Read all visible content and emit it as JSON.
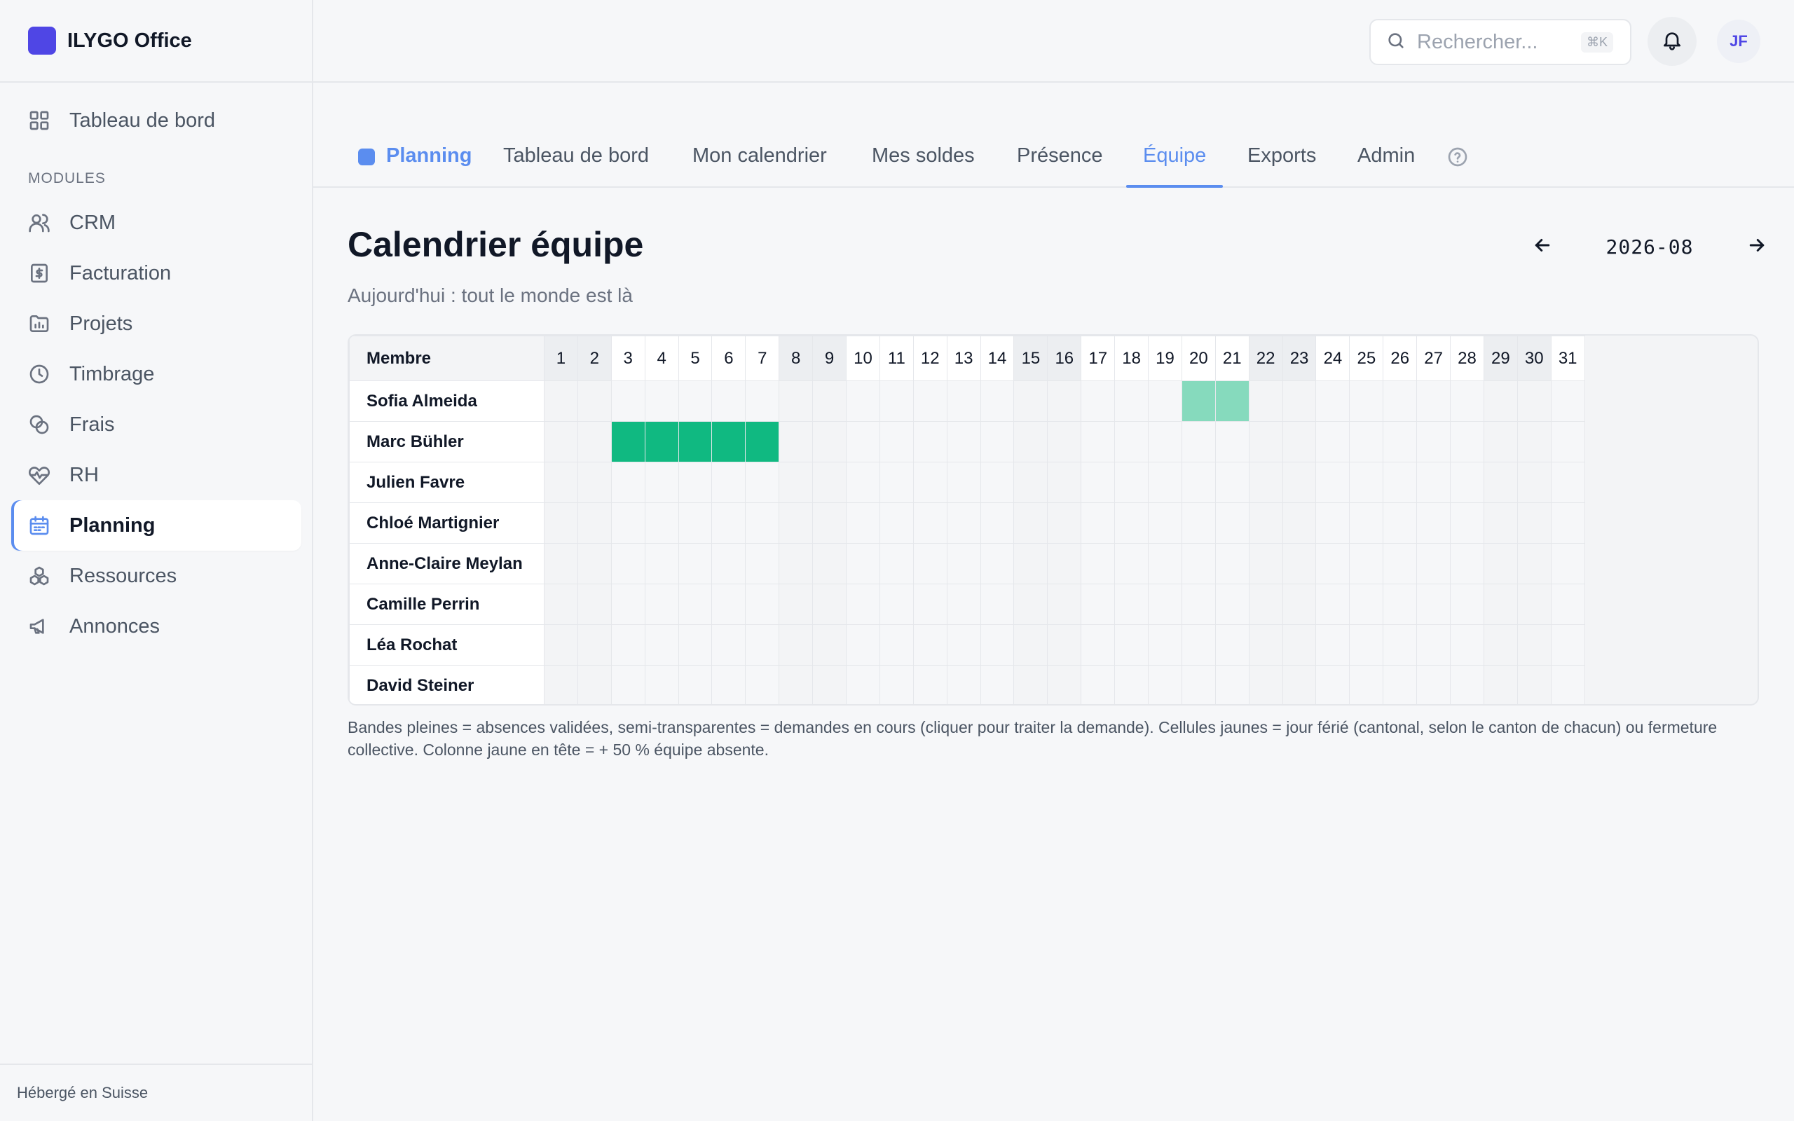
{
  "app": {
    "name": "ILYGO Office"
  },
  "sidebar": {
    "top_item": {
      "label": "Tableau de bord",
      "icon": "grid-icon"
    },
    "section_label": "MODULES",
    "items": [
      {
        "label": "CRM",
        "icon": "users-icon"
      },
      {
        "label": "Facturation",
        "icon": "invoice-icon"
      },
      {
        "label": "Projets",
        "icon": "folder-chart-icon"
      },
      {
        "label": "Timbrage",
        "icon": "clock-icon"
      },
      {
        "label": "Frais",
        "icon": "coins-icon"
      },
      {
        "label": "RH",
        "icon": "heart-pulse-icon"
      },
      {
        "label": "Planning",
        "icon": "calendar-icon",
        "active": true
      },
      {
        "label": "Ressources",
        "icon": "boxes-icon"
      },
      {
        "label": "Annonces",
        "icon": "megaphone-icon"
      }
    ],
    "footer": "Hébergé en Suisse"
  },
  "topbar": {
    "search_placeholder": "Rechercher...",
    "search_shortcut": "⌘K",
    "avatar_initials": "JF"
  },
  "tabs": {
    "home": "Planning",
    "items": [
      "Tableau de bord",
      "Mon calendrier",
      "Mes soldes",
      "Présence",
      "Équipe",
      "Exports",
      "Admin"
    ],
    "active": "Équipe"
  },
  "main": {
    "title": "Calendrier équipe",
    "subtitle": "Aujourd'hui : tout le monde est là",
    "month": "2026-08",
    "legend": "Bandes pleines = absences validées, semi-transparentes = demandes en cours (cliquer pour traiter la demande). Cellules jaunes = jour férié (cantonal, selon le canton de chacun) ou fermeture collective. Colonne jaune en tête = + 50 % équipe absente."
  },
  "calendar": {
    "member_header": "Membre",
    "days": [
      1,
      2,
      3,
      4,
      5,
      6,
      7,
      8,
      9,
      10,
      11,
      12,
      13,
      14,
      15,
      16,
      17,
      18,
      19,
      20,
      21,
      22,
      23,
      24,
      25,
      26,
      27,
      28,
      29,
      30,
      31
    ],
    "weekend_days": [
      1,
      2,
      8,
      9,
      15,
      16,
      22,
      23,
      29,
      30
    ],
    "members": [
      {
        "name": "Sofia Almeida",
        "validated": [],
        "pending": [
          20,
          21
        ]
      },
      {
        "name": "Marc Bühler",
        "validated": [
          3,
          4,
          5,
          6,
          7
        ],
        "pending": []
      },
      {
        "name": "Julien Favre",
        "validated": [],
        "pending": []
      },
      {
        "name": "Chloé Martignier",
        "validated": [],
        "pending": []
      },
      {
        "name": "Anne-Claire Meylan",
        "validated": [],
        "pending": []
      },
      {
        "name": "Camille Perrin",
        "validated": [],
        "pending": []
      },
      {
        "name": "Léa Rochat",
        "validated": [],
        "pending": []
      },
      {
        "name": "David Steiner",
        "validated": [],
        "pending": []
      }
    ],
    "colors": {
      "validated": "#10b981",
      "pending": "#86dabd",
      "accent": "#5b8def"
    }
  }
}
